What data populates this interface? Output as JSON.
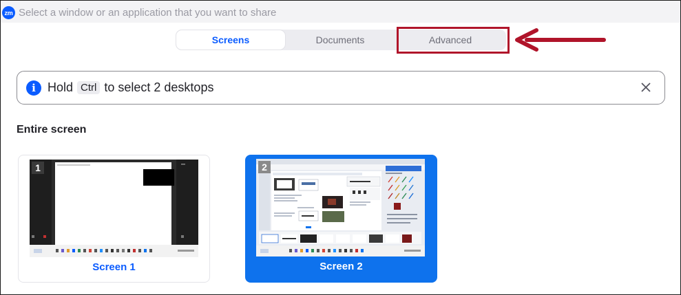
{
  "window": {
    "logo_text": "zm",
    "title": "Select a window or an application that you want to share"
  },
  "tabs": [
    {
      "label": "Screens",
      "active": true
    },
    {
      "label": "Documents",
      "active": false
    },
    {
      "label": "Advanced",
      "active": false
    }
  ],
  "info_bar": {
    "icon_glyph": "i",
    "text_before": "Hold",
    "key": "Ctrl",
    "text_after": "to select 2 desktops"
  },
  "section": {
    "title": "Entire screen"
  },
  "screens": [
    {
      "number": "1",
      "label": "Screen 1",
      "selected": false
    },
    {
      "number": "2",
      "label": "Screen 2",
      "selected": true
    }
  ],
  "colors": {
    "accent": "#0b5cff",
    "selected_card": "#0e72ed",
    "annotation": "#b0142a"
  }
}
